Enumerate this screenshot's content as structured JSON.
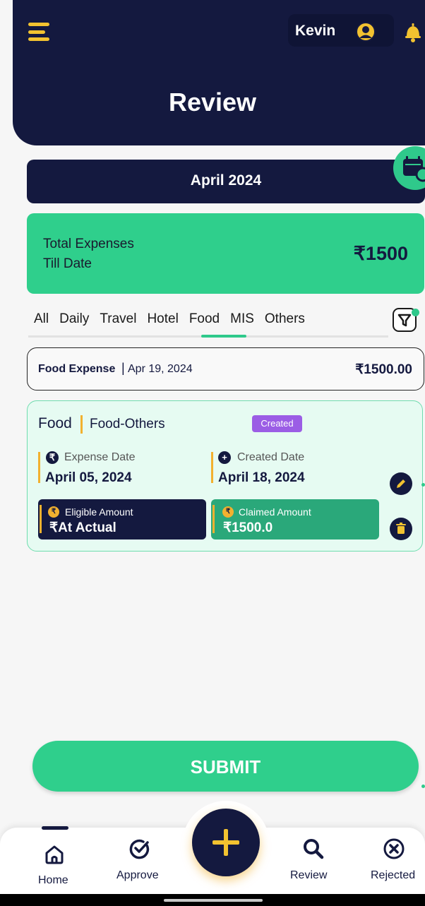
{
  "header": {
    "user_name": "Kevin",
    "title": "Review"
  },
  "period": {
    "month_label": "April 2024"
  },
  "total": {
    "label_line1": "Total Expenses",
    "label_line2": "Till Date",
    "amount": "₹1500"
  },
  "tabs": {
    "items": [
      "All",
      "Daily",
      "Travel",
      "Hotel",
      "Food",
      "MIS",
      "Others"
    ],
    "active": "Food"
  },
  "expense_summary": {
    "type": "Food Expense",
    "separator": "|",
    "date": "Apr 19, 2024",
    "amount": "₹1500.00"
  },
  "expense_detail": {
    "category": "Food",
    "subcategory": "Food-Others",
    "status": "Created",
    "expense_date_label": "Expense Date",
    "expense_date": "April 05, 2024",
    "created_date_label": "Created Date",
    "created_date": "April 18, 2024",
    "eligible_label": "Eligible Amount",
    "eligible_value": "₹At Actual",
    "claimed_label": "Claimed Amount",
    "claimed_value": "₹1500.0"
  },
  "actions": {
    "submit_label": "SUBMIT"
  },
  "bottom_nav": {
    "home": "Home",
    "approve": "Approve",
    "review": "Review",
    "rejected": "Rejected"
  },
  "colors": {
    "navy": "#14193f",
    "green": "#2fcf8c",
    "accent_yellow": "#f2b12f",
    "status_purple": "#9b5de5"
  },
  "icons": [
    "menu-icon",
    "user-circle-icon",
    "bell-icon",
    "calendar-icon",
    "filter-icon",
    "rupee-icon",
    "plus-circle-icon",
    "coin-icon",
    "edit-icon",
    "delete-icon",
    "home-icon",
    "approve-check-icon",
    "plus-icon",
    "search-icon",
    "rejected-x-icon"
  ]
}
